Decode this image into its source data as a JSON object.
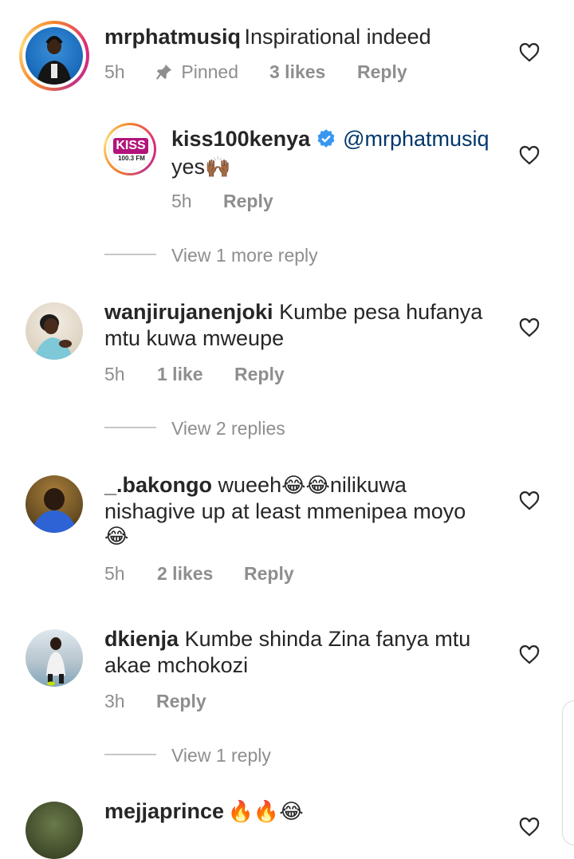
{
  "comments": [
    {
      "username": "mrphatmusiq",
      "text": "Inspirational indeed",
      "time": "5h",
      "pinned_label": "Pinned",
      "likes": "3 likes",
      "reply_label": "Reply",
      "reply": {
        "username": "kiss100kenya",
        "mention": "@mrphatmusiq",
        "text": "yes",
        "emoji": "🙌🏾",
        "time": "5h",
        "reply_label": "Reply",
        "avatar_text": "KISS",
        "avatar_subtext": "100.3 FM"
      },
      "view_more": "View 1 more reply"
    },
    {
      "username": "wanjirujanenjoki",
      "text_line1": "Kumbe pesa hufanya",
      "text_line2": "mtu kuwa mweupe",
      "time": "5h",
      "likes": "1 like",
      "reply_label": "Reply",
      "view_more": "View 2 replies"
    },
    {
      "username": "_.bakongo",
      "text_line1": "wueeh",
      "emoji1": "😂😂",
      "text_line1b": "nilikuwa",
      "text_line2": "nishagive up at least mmenipea moyo",
      "emoji2": "😂",
      "time": "5h",
      "likes": "2 likes",
      "reply_label": "Reply"
    },
    {
      "username": "dkienja",
      "text_line1": "Kumbe shinda Zina fanya mtu",
      "text_line2": "akae mchokozi",
      "time": "3h",
      "reply_label": "Reply",
      "view_more": "View 1 reply"
    },
    {
      "username": "mejjaprince",
      "emoji": "🔥🔥😂"
    }
  ],
  "colors": {
    "text": "#262626",
    "meta": "#8e8e8e",
    "mention": "#00376b",
    "verified": "#3897f0",
    "kiss_brand": "#b2147a"
  },
  "icons": {
    "like": "heart-outline-icon",
    "pin": "pin-icon",
    "verified": "verified-badge-icon"
  }
}
